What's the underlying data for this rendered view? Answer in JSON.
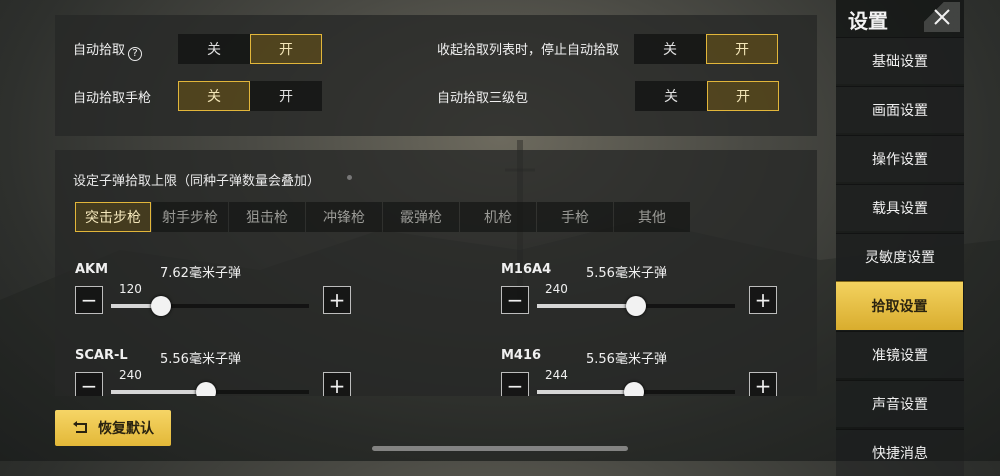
{
  "auto_pickup": {
    "row1_left_label": "自动拾取",
    "row1_right_label": "收起拾取列表时，停止自动拾取",
    "row2_left_label": "自动拾取手枪",
    "row2_right_label": "自动拾取三级包",
    "help_glyph": "?",
    "off_label": "关",
    "on_label": "开"
  },
  "ammo_section": {
    "title": "设定子弹拾取上限（同种子弹数量会叠加）",
    "tabs": [
      "突击步枪",
      "射手步枪",
      "狙击枪",
      "冲锋枪",
      "霰弹枪",
      "机枪",
      "手枪",
      "其他"
    ],
    "selected_tab": "突击步枪"
  },
  "guns": [
    {
      "name": "AKM",
      "ammo": "7.62毫米子弹",
      "value": "120",
      "fill_fraction": 0.25
    },
    {
      "name": "M16A4",
      "ammo": "5.56毫米子弹",
      "value": "240",
      "fill_fraction": 0.5
    },
    {
      "name": "SCAR-L",
      "ammo": "5.56毫米子弹",
      "value": "240",
      "fill_fraction": 0.48
    },
    {
      "name": "M416",
      "ammo": "5.56毫米子弹",
      "value": "244",
      "fill_fraction": 0.49
    }
  ],
  "minus_glyph": "−",
  "plus_glyph": "+",
  "reset_label": "恢复默认",
  "sidebar": {
    "title": "设置",
    "close_glyph": "✕",
    "items": [
      "基础设置",
      "画面设置",
      "操作设置",
      "载具设置",
      "灵敏度设置",
      "拾取设置",
      "准镜设置",
      "声音设置",
      "快捷消息"
    ],
    "selected": "拾取设置"
  },
  "colors": {
    "accent_gold": "#e2b63a",
    "selected_tab_bg": "#f3d25f"
  },
  "icons": {
    "help": "help-icon",
    "reset": "reset-icon",
    "close": "close-icon"
  }
}
